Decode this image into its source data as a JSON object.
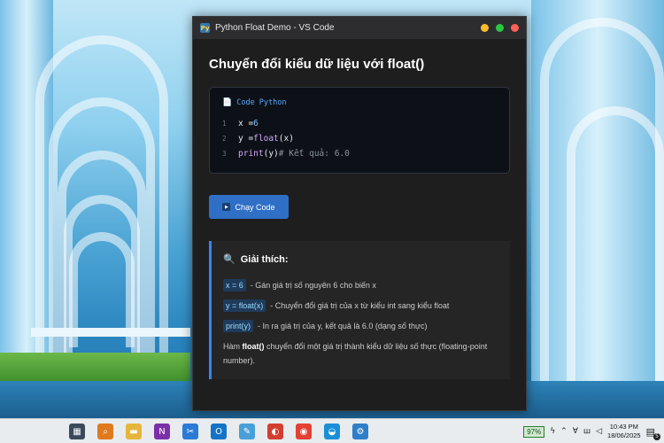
{
  "window": {
    "title": "Python Float Demo - VS Code",
    "app_icon": "Py"
  },
  "main": {
    "heading": "Chuyển đổi kiểu dữ liệu với float()",
    "code": {
      "icon": "📄",
      "label": "Code Python",
      "lines": [
        {
          "no": "1",
          "parts": [
            "x = ",
            "6",
            ""
          ]
        },
        {
          "no": "2",
          "parts": [
            "y = ",
            "float",
            "(x)"
          ]
        },
        {
          "no": "3",
          "parts": [
            "print",
            "(y) ",
            "# Kết quả: 6.0"
          ]
        }
      ]
    },
    "run_button": {
      "icon": "▶",
      "label": "Chạy Code"
    },
    "explain": {
      "icon": "🔍",
      "title": "Giải thích:",
      "items": [
        {
          "code": "x = 6",
          "text": "- Gán giá trị số nguyên 6 cho biến x"
        },
        {
          "code": "y = float(x)",
          "text": "- Chuyển đổi giá trị của x từ kiểu int sang kiểu float"
        },
        {
          "code": "print(y)",
          "text": "- In ra giá trị của y, kết quả là 6.0 (dạng số thực)"
        }
      ],
      "desc_prefix": "Hàm ",
      "desc_bold": "float()",
      "desc_suffix": " chuyển đổi một giá trị thành kiểu dữ liệu số thực (floating-point number)."
    }
  },
  "taskbar": {
    "apps": [
      {
        "name": "calculator-icon",
        "glyph": "▦",
        "color": "#3a4a5c"
      },
      {
        "name": "search-icon",
        "glyph": "⌕",
        "color": "#e07a1f"
      },
      {
        "name": "file-explorer-icon",
        "glyph": "▬",
        "color": "#e6b63c"
      },
      {
        "name": "onenote-icon",
        "glyph": "N",
        "color": "#7b2fa8"
      },
      {
        "name": "snipping-icon",
        "glyph": "✂",
        "color": "#2a7ad6"
      },
      {
        "name": "outlook-icon",
        "glyph": "O",
        "color": "#1473c9"
      },
      {
        "name": "notepad-icon",
        "glyph": "✎",
        "color": "#4a9fd8"
      },
      {
        "name": "paint-icon",
        "glyph": "◐",
        "color": "#d23f2f"
      },
      {
        "name": "chrome-icon",
        "glyph": "◉",
        "color": "#e34133"
      },
      {
        "name": "edge-icon",
        "glyph": "◒",
        "color": "#1a8fd8"
      },
      {
        "name": "settings-icon",
        "glyph": "⚙",
        "color": "#2f7fc8"
      }
    ],
    "battery": "97%",
    "time": "10:43 PM",
    "date": "18/06/2025",
    "notifications": "5"
  }
}
